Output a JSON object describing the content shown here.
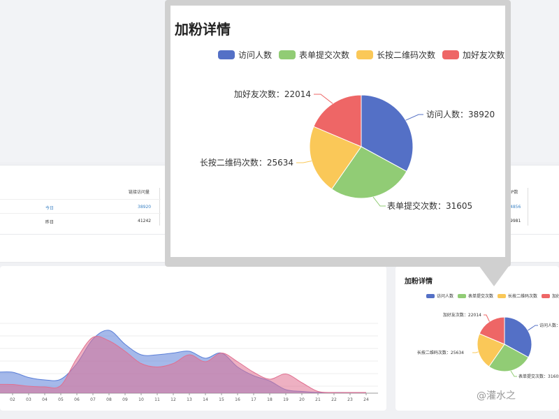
{
  "chart_data": [
    {
      "type": "pie",
      "title": "加粉详情",
      "legend_position": "top",
      "categories": [
        "访问人数",
        "表单提交次数",
        "长按二维码次数",
        "加好友次数"
      ],
      "values": [
        38920,
        31605,
        25634,
        22014
      ],
      "colors": [
        "#5470c6",
        "#91cc75",
        "#fac858",
        "#ee6666"
      ],
      "labels": [
        "访问人数：38920",
        "表单提交次数：31605",
        "长按二维码次数：25634",
        "加好友次数：22014"
      ]
    },
    {
      "type": "area",
      "x": [
        "02",
        "03",
        "04",
        "05",
        "06",
        "07",
        "08",
        "09",
        "10",
        "11",
        "12",
        "13",
        "14",
        "15",
        "16",
        "17",
        "18",
        "19",
        "20",
        "21",
        "22",
        "23",
        "24"
      ],
      "series": [
        {
          "color": "#5b7fd8",
          "values": [
            60,
            45,
            38,
            40,
            85,
            155,
            180,
            140,
            110,
            110,
            115,
            120,
            100,
            115,
            75,
            50,
            35,
            10,
            5,
            2,
            2,
            2,
            2
          ]
        },
        {
          "color": "#e07090",
          "values": [
            25,
            20,
            18,
            22,
            100,
            160,
            150,
            120,
            85,
            75,
            85,
            110,
            90,
            115,
            90,
            60,
            40,
            55,
            30,
            5,
            2,
            2,
            2
          ]
        }
      ]
    }
  ],
  "stats": {
    "col_header": "链接访问量",
    "col_header_right": "IP数",
    "rows": [
      {
        "label": "今日",
        "value": "38920",
        "right_value": "4856"
      },
      {
        "label": "昨日",
        "value": "41242",
        "right_value": "9981"
      }
    ]
  },
  "watermark": "@灌水之"
}
